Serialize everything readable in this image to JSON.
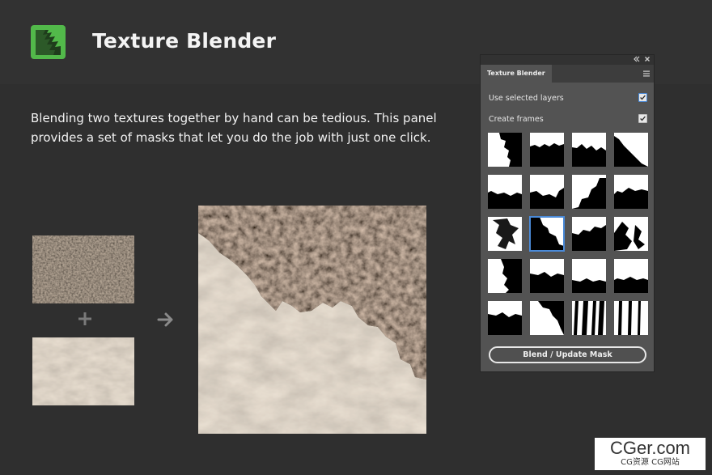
{
  "page": {
    "title": "Texture Blender",
    "description": "Blending two textures together by hand can be tedious. This panel provides a set of masks that let you do the job with just one click."
  },
  "colors": {
    "background": "#2f2f2f",
    "header": "#323232",
    "logo_green": "#52b94a",
    "panel_bg": "#535353",
    "accent_blue": "#4a8ad8"
  },
  "illustration": {
    "source_a": "leaf-litter-texture",
    "source_b": "sand-texture",
    "result": "blended-texture",
    "plus_icon": "plus-icon",
    "arrow_icon": "arrow-right-icon"
  },
  "panel": {
    "tab_label": "Texture Blender",
    "options": [
      {
        "label": "Use selected layers",
        "checked": true
      },
      {
        "label": "Create frames",
        "checked": true
      }
    ],
    "masks": {
      "count": 20,
      "rows": 5,
      "columns": 4,
      "selected_index": 5
    },
    "blend_button": "Blend / Update Mask"
  },
  "watermark": {
    "main": "CGer.com",
    "sub": "CG资源 CG网站"
  }
}
